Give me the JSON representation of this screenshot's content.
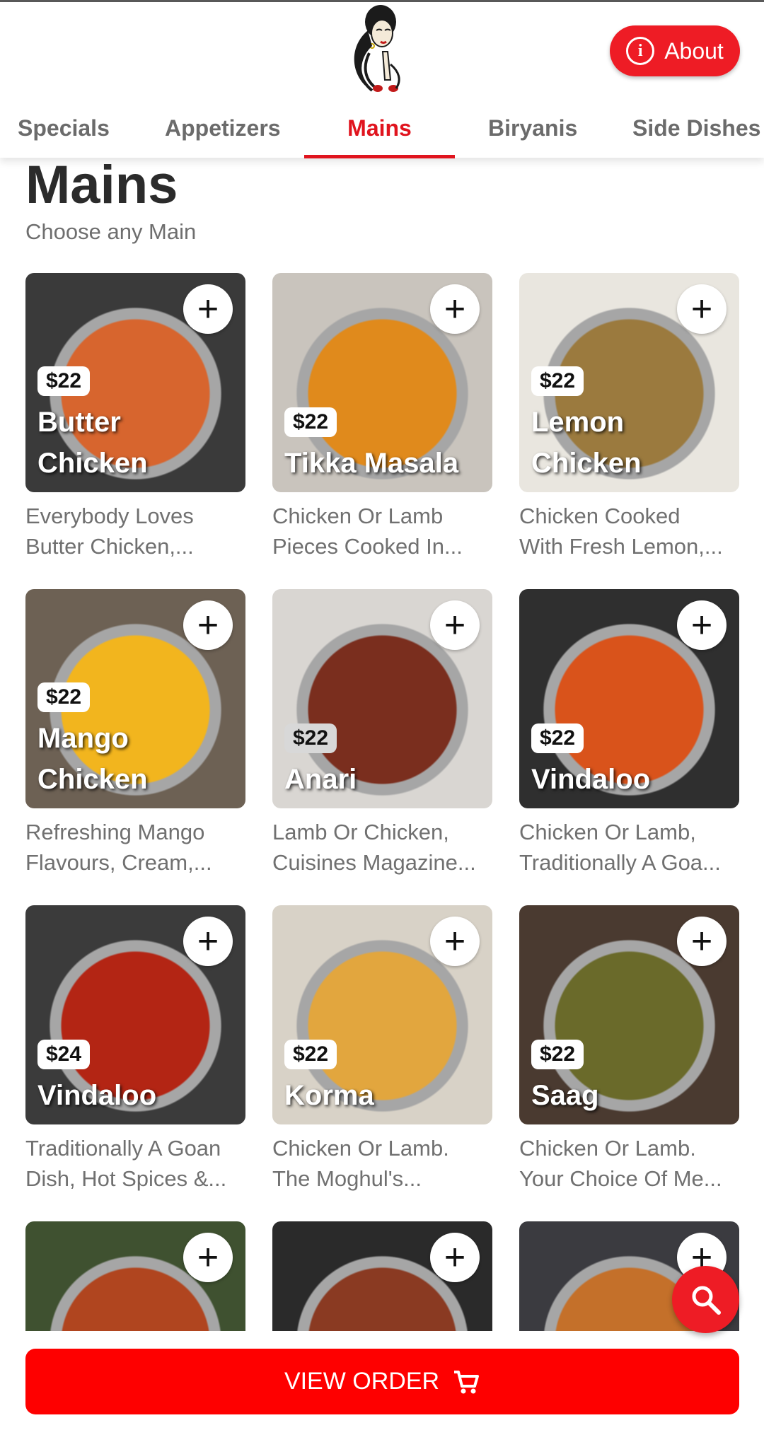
{
  "header": {
    "about_label": "About",
    "about_icon": "info-icon"
  },
  "tabs": [
    {
      "label": "Specials"
    },
    {
      "label": "Appetizers"
    },
    {
      "label": "Mains",
      "active": true
    },
    {
      "label": "Biryanis"
    },
    {
      "label": "Side Dishes"
    }
  ],
  "section": {
    "title": "Mains",
    "subtitle": "Choose any Main"
  },
  "items": [
    {
      "name": "Butter\nChicken",
      "price": "$22",
      "desc": "Everybody Loves\nButter Chicken,...",
      "bg": "#3a3a3a",
      "food": "#d7652e"
    },
    {
      "name": "Tikka Masala",
      "price": "$22",
      "desc": "Chicken Or Lamb\nPieces Cooked In...",
      "bg": "#c9c4bd",
      "food": "#e08a1c"
    },
    {
      "name": "Lemon\nChicken",
      "price": "$22",
      "desc": "Chicken Cooked\nWith Fresh Lemon,...",
      "bg": "#e9e6df",
      "food": "#9b7a3e"
    },
    {
      "name": "Mango\nChicken",
      "price": "$22",
      "desc": "Refreshing Mango\nFlavours, Cream,...",
      "bg": "#6d6154",
      "food": "#f2b51e"
    },
    {
      "name": "Anari",
      "price": "$22",
      "desc": "Lamb Or Chicken,\nCuisines Magazine...",
      "bg": "#d9d6d2",
      "food": "#7a2e1e"
    },
    {
      "name": "Vindaloo",
      "price": "$22",
      "desc": "Chicken Or Lamb,\nTraditionally A Goa...",
      "bg": "#2f2f2f",
      "food": "#d9531b"
    },
    {
      "name": "Vindaloo",
      "price": "$24",
      "desc": "Traditionally A Goan\nDish, Hot Spices &...",
      "bg": "#3b3b3b",
      "food": "#b32514"
    },
    {
      "name": "Korma",
      "price": "$22",
      "desc": "Chicken Or Lamb.\nThe Moghul's...",
      "bg": "#d8d2c7",
      "food": "#e2a63e"
    },
    {
      "name": "Saag",
      "price": "$22",
      "desc": "Chicken Or Lamb.\nYour Choice Of Me...",
      "bg": "#4a3a30",
      "food": "#6a6a2a"
    },
    {
      "name": "",
      "price": "",
      "desc": "",
      "bg": "#3f5130",
      "food": "#b0451f"
    },
    {
      "name": "",
      "price": "",
      "desc": "",
      "bg": "#2a2a2a",
      "food": "#8a3a22"
    },
    {
      "name": "",
      "price": "",
      "desc": "",
      "bg": "#3b3b40",
      "food": "#c4702a"
    }
  ],
  "add_symbol": "+",
  "view_order": {
    "label": "VIEW ORDER",
    "icon": "cart-icon"
  },
  "search_fab": {
    "icon": "search-icon"
  }
}
